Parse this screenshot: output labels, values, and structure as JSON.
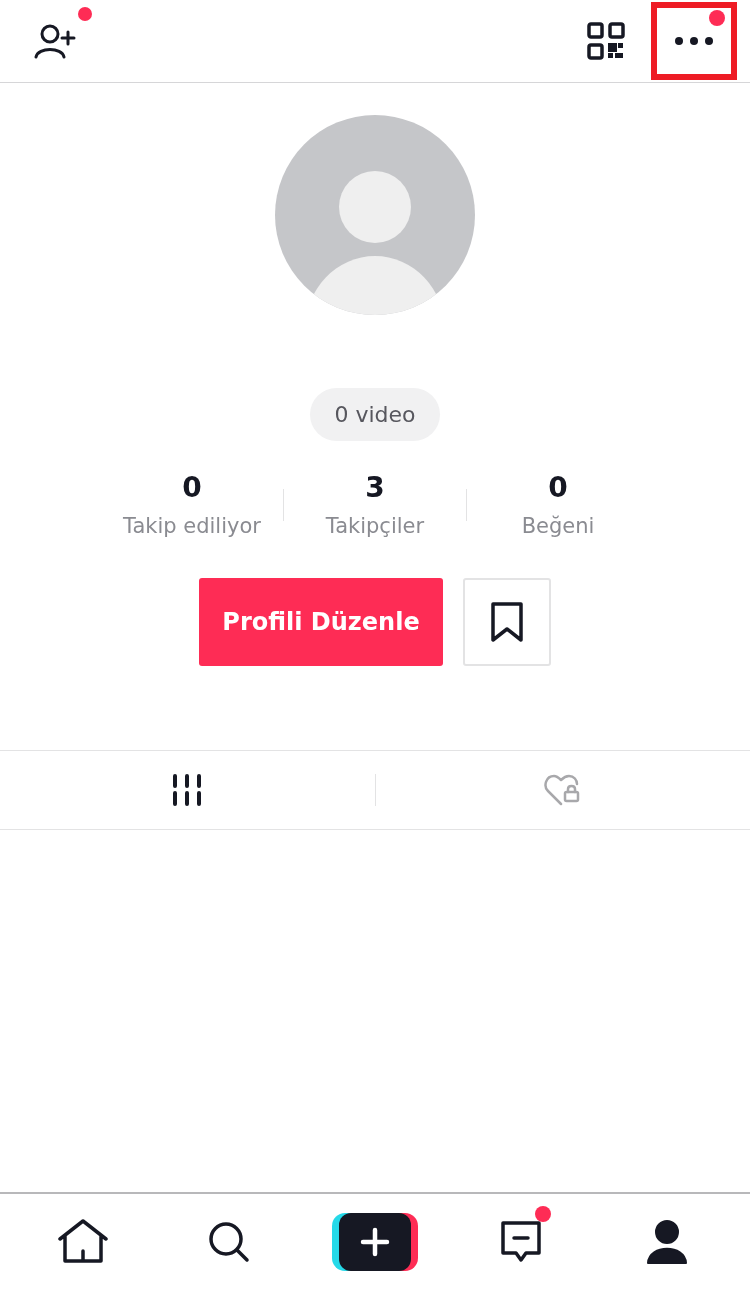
{
  "top_bar": {
    "add_friend_badge": true,
    "more_badge": true,
    "more_highlighted": true
  },
  "profile": {
    "video_count": "0 video"
  },
  "stats": [
    {
      "value": "0",
      "label": "Takip ediliyor"
    },
    {
      "value": "3",
      "label": "Takipçiler"
    },
    {
      "value": "0",
      "label": "Beğeni"
    }
  ],
  "edit_button": "Profili Düzenle",
  "content_tabs": [
    {
      "kind": "videos",
      "selected": true
    },
    {
      "kind": "liked",
      "selected": false
    }
  ],
  "bottom_nav": [
    {
      "kind": "home",
      "selected": false,
      "badge": false
    },
    {
      "kind": "search",
      "selected": false,
      "badge": false
    },
    {
      "kind": "create",
      "selected": false,
      "badge": false
    },
    {
      "kind": "inbox",
      "selected": false,
      "badge": true
    },
    {
      "kind": "profile",
      "selected": true,
      "badge": false
    }
  ]
}
